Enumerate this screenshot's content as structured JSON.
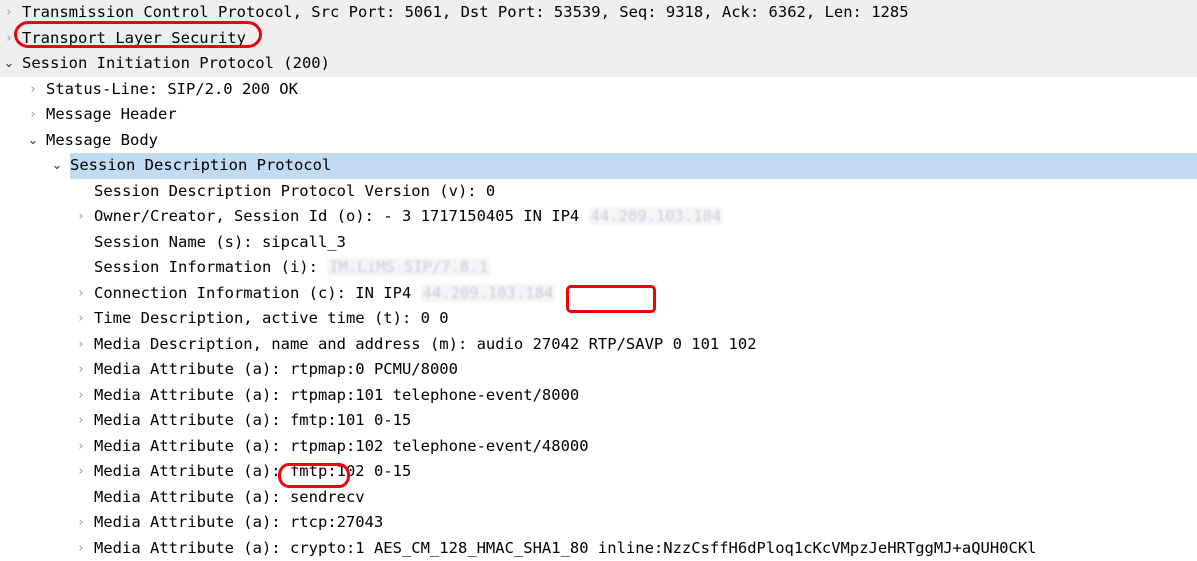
{
  "app": {
    "name": "wireshark-packet-details",
    "view": "packet-detail-tree"
  },
  "colors": {
    "selection_blue": "#c2dbf2",
    "band_gray": "#efefef",
    "annotation_red": "#e8060c",
    "twisty_gray": "#9a9a9a",
    "redacted_gray": "#c9ccd1"
  },
  "icons": {
    "collapsed": "›",
    "expanded": "⌄"
  },
  "tree": {
    "rows": [
      {
        "id": "tcp",
        "indent": 0,
        "state": "collapsed",
        "band": "gray",
        "selected": false,
        "label": "Transmission Control Protocol, Src Port: 5061, Dst Port: 53539, Seq: 9318, Ack: 6362, Len: 1285"
      },
      {
        "id": "tls",
        "indent": 0,
        "state": "collapsed",
        "band": "gray",
        "selected": false,
        "annotated": true,
        "label": "Transport Layer Security"
      },
      {
        "id": "sip",
        "indent": 0,
        "state": "expanded",
        "band": "gray",
        "selected": false,
        "label": "Session Initiation Protocol (200)"
      },
      {
        "id": "status-line",
        "indent": 1,
        "state": "collapsed",
        "band": "white",
        "selected": false,
        "label": "Status-Line: SIP/2.0 200 OK"
      },
      {
        "id": "message-header",
        "indent": 1,
        "state": "collapsed",
        "band": "white",
        "selected": false,
        "label": "Message Header"
      },
      {
        "id": "message-body",
        "indent": 1,
        "state": "expanded",
        "band": "white",
        "selected": false,
        "label": "Message Body"
      },
      {
        "id": "sdp",
        "indent": 2,
        "state": "expanded",
        "band": "white",
        "selected": true,
        "label": "Session Description Protocol"
      },
      {
        "id": "sdp-version",
        "indent": 3,
        "state": "none",
        "band": "white",
        "selected": false,
        "label": "Session Description Protocol Version (v): 0"
      },
      {
        "id": "sdp-owner",
        "indent": 3,
        "state": "collapsed",
        "band": "white",
        "selected": false,
        "label": "Owner/Creator, Session Id (o): - 3 1717150405 IN IP4 ",
        "redacted": "44.209.103.184"
      },
      {
        "id": "sdp-session-name",
        "indent": 3,
        "state": "none",
        "band": "white",
        "selected": false,
        "label": "Session Name (s): sipcall_3"
      },
      {
        "id": "sdp-session-information",
        "indent": 3,
        "state": "none",
        "band": "white",
        "selected": false,
        "label": "Session Information (i): ",
        "redacted": "IM.LiMS SIP/7.8.1"
      },
      {
        "id": "sdp-connection-information",
        "indent": 3,
        "state": "collapsed",
        "band": "white",
        "selected": false,
        "label": "Connection Information (c): IN IP4 ",
        "redacted": "44.209.103.184"
      },
      {
        "id": "sdp-time-description",
        "indent": 3,
        "state": "collapsed",
        "band": "white",
        "selected": false,
        "label": "Time Description, active time (t): 0 0"
      },
      {
        "id": "sdp-media-description",
        "indent": 3,
        "state": "collapsed",
        "band": "white",
        "selected": false,
        "annotated": true,
        "label": "Media Description, name and address (m): audio 27042 RTP/SAVP 0 101 102"
      },
      {
        "id": "sdp-attr-rtpmap-0",
        "indent": 3,
        "state": "collapsed",
        "band": "white",
        "selected": false,
        "label": "Media Attribute (a): rtpmap:0 PCMU/8000"
      },
      {
        "id": "sdp-attr-rtpmap-101",
        "indent": 3,
        "state": "collapsed",
        "band": "white",
        "selected": false,
        "label": "Media Attribute (a): rtpmap:101 telephone-event/8000"
      },
      {
        "id": "sdp-attr-fmtp-101",
        "indent": 3,
        "state": "collapsed",
        "band": "white",
        "selected": false,
        "label": "Media Attribute (a): fmtp:101 0-15"
      },
      {
        "id": "sdp-attr-rtpmap-102",
        "indent": 3,
        "state": "collapsed",
        "band": "white",
        "selected": false,
        "label": "Media Attribute (a): rtpmap:102 telephone-event/48000"
      },
      {
        "id": "sdp-attr-fmtp-102",
        "indent": 3,
        "state": "collapsed",
        "band": "white",
        "selected": false,
        "label": "Media Attribute (a): fmtp:102 0-15"
      },
      {
        "id": "sdp-attr-sendrecv",
        "indent": 3,
        "state": "none",
        "band": "white",
        "selected": false,
        "label": "Media Attribute (a): sendrecv"
      },
      {
        "id": "sdp-attr-rtcp",
        "indent": 3,
        "state": "collapsed",
        "band": "white",
        "selected": false,
        "label": "Media Attribute (a): rtcp:27043"
      },
      {
        "id": "sdp-attr-crypto",
        "indent": 3,
        "state": "collapsed",
        "band": "white",
        "selected": false,
        "annotated": true,
        "label": "Media Attribute (a): crypto:1 AES_CM_128_HMAC_SHA1_80 inline:NzzCsffH6dPloq1cKcVMpzJeHRTggMJ+aQUH0CKl"
      }
    ]
  },
  "annotations": [
    {
      "id": "annot-tls",
      "target": "Transport Layer Security",
      "shape": "oval",
      "color": "#e8060c"
    },
    {
      "id": "annot-rtp-savp",
      "target": "RTP/SAVP",
      "shape": "rounded-rect",
      "color": "#e8060c"
    },
    {
      "id": "annot-crypto",
      "target": "crypto",
      "shape": "oval",
      "color": "#e8060c"
    }
  ]
}
